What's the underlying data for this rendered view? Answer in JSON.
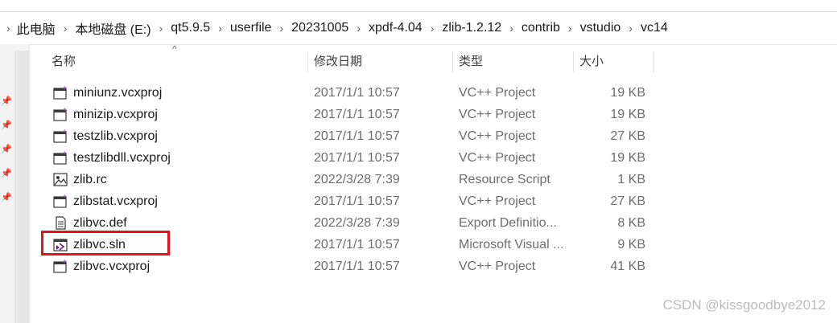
{
  "addressbar": {
    "crumbs": [
      "此电脑",
      "本地磁盘 (E:)",
      "qt5.9.5",
      "userfile",
      "20231005",
      "xpdf-4.04",
      "zlib-1.2.12",
      "contrib",
      "vstudio",
      "vc14"
    ]
  },
  "columns": {
    "name": "名称",
    "date": "修改日期",
    "type": "类型",
    "size": "大小"
  },
  "files": [
    {
      "name": "miniunz.vcxproj",
      "date": "2017/1/1 10:57",
      "type": "VC++ Project",
      "size": "19 KB",
      "icon": "vcxproj-icon"
    },
    {
      "name": "minizip.vcxproj",
      "date": "2017/1/1 10:57",
      "type": "VC++ Project",
      "size": "19 KB",
      "icon": "vcxproj-icon"
    },
    {
      "name": "testzlib.vcxproj",
      "date": "2017/1/1 10:57",
      "type": "VC++ Project",
      "size": "27 KB",
      "icon": "vcxproj-icon"
    },
    {
      "name": "testzlibdll.vcxproj",
      "date": "2017/1/1 10:57",
      "type": "VC++ Project",
      "size": "19 KB",
      "icon": "vcxproj-icon"
    },
    {
      "name": "zlib.rc",
      "date": "2022/3/28 7:39",
      "type": "Resource Script",
      "size": "1 KB",
      "icon": "resource-script-icon"
    },
    {
      "name": "zlibstat.vcxproj",
      "date": "2017/1/1 10:57",
      "type": "VC++ Project",
      "size": "27 KB",
      "icon": "vcxproj-icon"
    },
    {
      "name": "zlibvc.def",
      "date": "2022/3/28 7:39",
      "type": "Export Definitio...",
      "size": "8 KB",
      "icon": "text-file-icon"
    },
    {
      "name": "zlibvc.sln",
      "date": "2017/1/1 10:57",
      "type": "Microsoft Visual ...",
      "size": "9 KB",
      "icon": "visual-studio-solution-icon"
    },
    {
      "name": "zlibvc.vcxproj",
      "date": "2017/1/1 10:57",
      "type": "VC++ Project",
      "size": "41 KB",
      "icon": "vcxproj-icon"
    }
  ],
  "watermark": "CSDN @kissgoodbye2012",
  "colors": {
    "highlight": "#e0141e",
    "vcxproj_accent": "#9b4dca",
    "vs_purple": "#68217a"
  }
}
